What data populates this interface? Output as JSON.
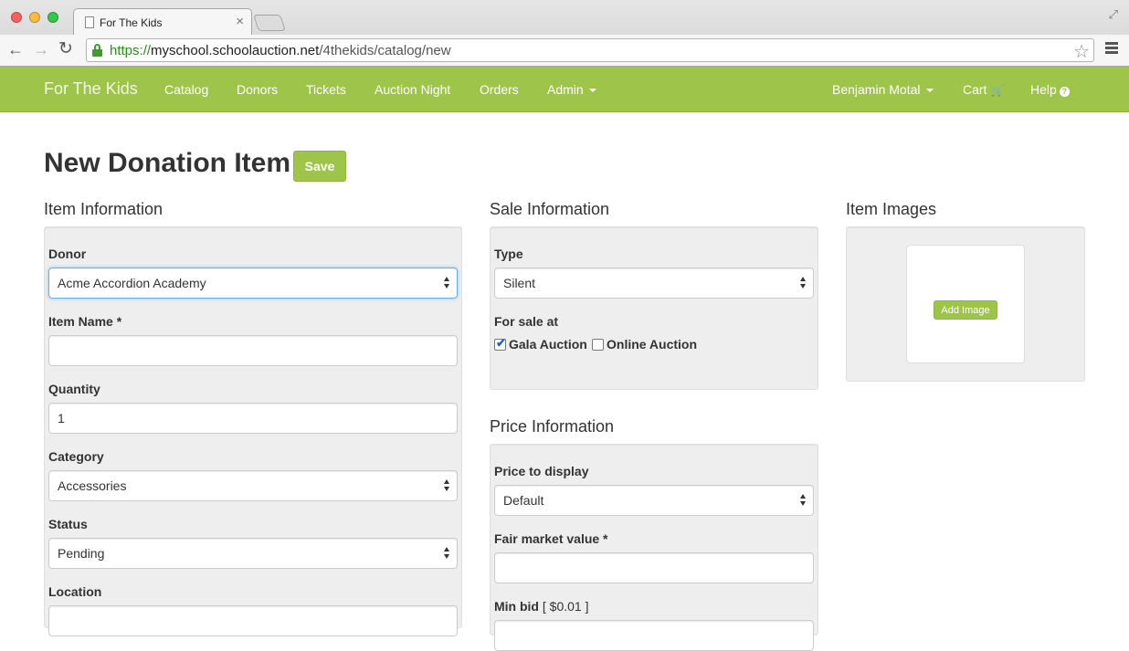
{
  "browser": {
    "tab_title": "For The Kids",
    "tab_close": "×",
    "url_scheme": "https",
    "url_sep": "://",
    "url_host": "myschool.schoolauction.net",
    "url_path": "/4thekids/catalog/new",
    "back_glyph": "←",
    "forward_glyph": "→",
    "reload_glyph": "↻",
    "star_glyph": "☆",
    "fullscreen_glyph": "⤢"
  },
  "navbar": {
    "color": "#9ec549",
    "brand": "For The Kids",
    "items": [
      {
        "label": "Catalog"
      },
      {
        "label": "Donors"
      },
      {
        "label": "Tickets"
      },
      {
        "label": "Auction Night"
      },
      {
        "label": "Orders"
      },
      {
        "label": "Admin"
      }
    ],
    "user": "Benjamin Motal",
    "cart": "Cart",
    "help": "Help",
    "cart_glyph": "🛒",
    "help_glyph": "?"
  },
  "page": {
    "title": "New Donation Item",
    "save_label": "Save"
  },
  "item_information": {
    "title": "Item Information",
    "donor_label": "Donor",
    "donor_value": "Acme Accordion Academy",
    "item_name_label": "Item Name *",
    "item_name_value": "",
    "quantity_label": "Quantity",
    "quantity_value": "1",
    "category_label": "Category",
    "category_value": "Accessories",
    "status_label": "Status",
    "status_value": "Pending",
    "location_label": "Location",
    "location_value": ""
  },
  "sale_information": {
    "title": "Sale Information",
    "type_label": "Type",
    "type_value": "Silent",
    "for_sale_label": "For sale at",
    "gala_label": "Gala Auction",
    "gala_checked": true,
    "online_label": "Online Auction",
    "online_checked": false
  },
  "price_information": {
    "title": "Price Information",
    "price_display_label": "Price to display",
    "price_display_value": "Default",
    "fair_market_label": "Fair market value *",
    "fair_market_value": "",
    "min_bid_label": "Min bid",
    "min_bid_hint": "[ $0.01 ]"
  },
  "item_images": {
    "title": "Item Images",
    "add_image_label": "Add Image"
  }
}
